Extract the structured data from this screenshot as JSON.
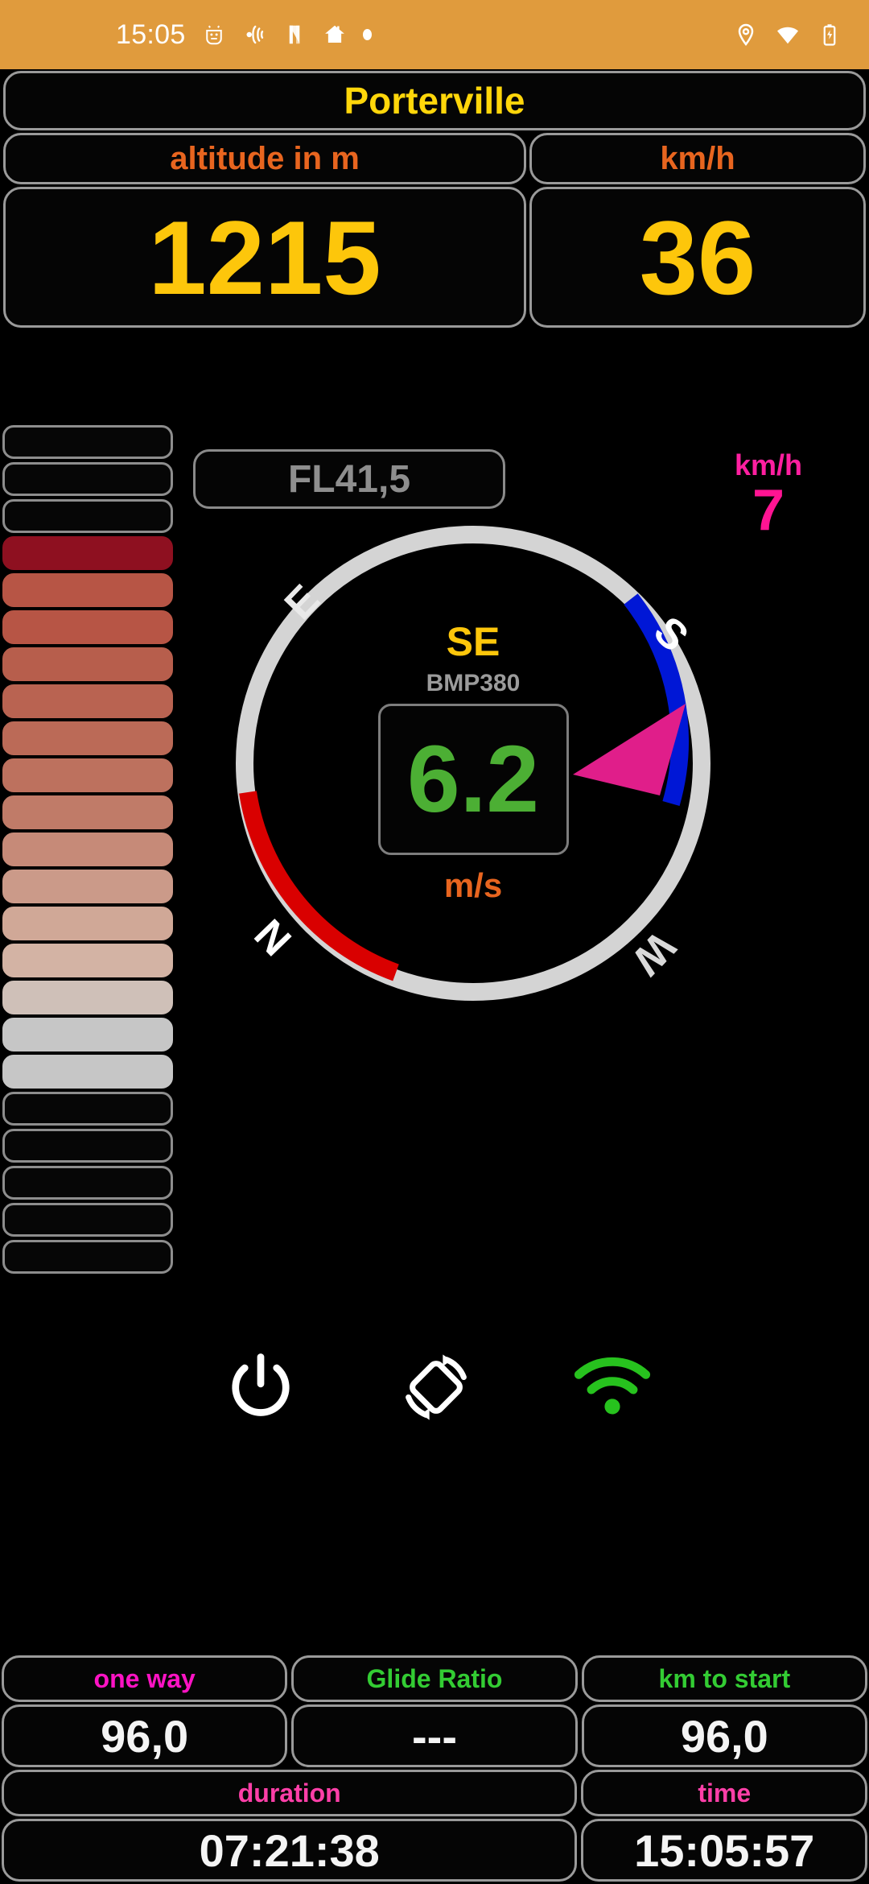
{
  "statusbar": {
    "clock": "15:05",
    "left_icons": [
      "android-debug-icon",
      "vibrate-icon",
      "netflix-icon",
      "home-icon",
      "more-dot-icon"
    ],
    "right_icons": [
      "location-pin-icon",
      "wifi-icon",
      "battery-charging-icon"
    ],
    "bg_color": "#e09b3d"
  },
  "header": {
    "location_title": "Porterville",
    "title_color": "#ffd60a"
  },
  "metrics": {
    "altitude_unit": "altitude in m",
    "altitude_value": "1215",
    "speed_unit": "km/h",
    "speed_value": "36",
    "unit_color": "#e8651f",
    "value_color": "#fdc60b"
  },
  "flight_level": {
    "label": "FL41,5",
    "color": "#8e8e8e"
  },
  "wind": {
    "unit": "km/h",
    "value": "7",
    "color": "#ff1493"
  },
  "compass": {
    "direction": "SE",
    "sensor": "BMP380",
    "vario_value": "6.2",
    "vario_unit": "m/s",
    "cardinal_n": "N",
    "cardinal_e": "E",
    "cardinal_s": "S",
    "cardinal_w": "W",
    "direction_color": "#fdc60b",
    "sensor_color": "#9b9b9b",
    "vario_color": "#4caf34",
    "unit_color": "#e8651f",
    "needle_color": "#e01e8a",
    "arc_red": "#d90000",
    "arc_blue": "#0017d6",
    "arc_grey": "#d4d4d4"
  },
  "controls": [
    {
      "name": "power-icon",
      "color": "#ffffff"
    },
    {
      "name": "screen-rotation-icon",
      "color": "#ffffff"
    },
    {
      "name": "wifi-icon",
      "color": "#27c21e"
    }
  ],
  "vario_ladder": {
    "bars": [
      {
        "fill": "none",
        "border": "#8d8d8d"
      },
      {
        "fill": "none",
        "border": "#8d8d8d"
      },
      {
        "fill": "none",
        "border": "#8d8d8d"
      },
      {
        "fill": "#8e1020",
        "border": "#8e1020"
      },
      {
        "fill": "#b75545",
        "border": "#b75545"
      },
      {
        "fill": "#b75545",
        "border": "#b75545"
      },
      {
        "fill": "#b75e4c",
        "border": "#b75e4c"
      },
      {
        "fill": "#b96351",
        "border": "#b96351"
      },
      {
        "fill": "#bb6a57",
        "border": "#bb6a57"
      },
      {
        "fill": "#bd715e",
        "border": "#bd715e"
      },
      {
        "fill": "#c07b68",
        "border": "#c07b68"
      },
      {
        "fill": "#c68a78",
        "border": "#c68a78"
      },
      {
        "fill": "#cb9a89",
        "border": "#cb9a89"
      },
      {
        "fill": "#d0a897",
        "border": "#d0a897"
      },
      {
        "fill": "#d3b3a4",
        "border": "#d3b3a4"
      },
      {
        "fill": "#cfc0b8",
        "border": "#cfc0b8"
      },
      {
        "fill": "#c6c6c6",
        "border": "#c6c6c6"
      },
      {
        "fill": "#c6c6c6",
        "border": "#c6c6c6"
      },
      {
        "fill": "none",
        "border": "#8d8d8d"
      },
      {
        "fill": "none",
        "border": "#8d8d8d"
      },
      {
        "fill": "none",
        "border": "#8d8d8d"
      },
      {
        "fill": "none",
        "border": "#8d8d8d"
      },
      {
        "fill": "none",
        "border": "#8d8d8d"
      }
    ]
  },
  "stats": {
    "row1": [
      {
        "label": "one way",
        "label_color": "#ff13c4",
        "value": "96,0"
      },
      {
        "label": "Glide Ratio",
        "label_color": "#33cc33",
        "value": "---"
      },
      {
        "label": "km to start",
        "label_color": "#33cc33",
        "value": "96,0"
      }
    ],
    "row2": [
      {
        "label": "duration",
        "label_color": "#ff3fa8",
        "value": "07:21:38"
      },
      {
        "label": "time",
        "label_color": "#ff3fa8",
        "value": "15:05:57"
      }
    ]
  }
}
